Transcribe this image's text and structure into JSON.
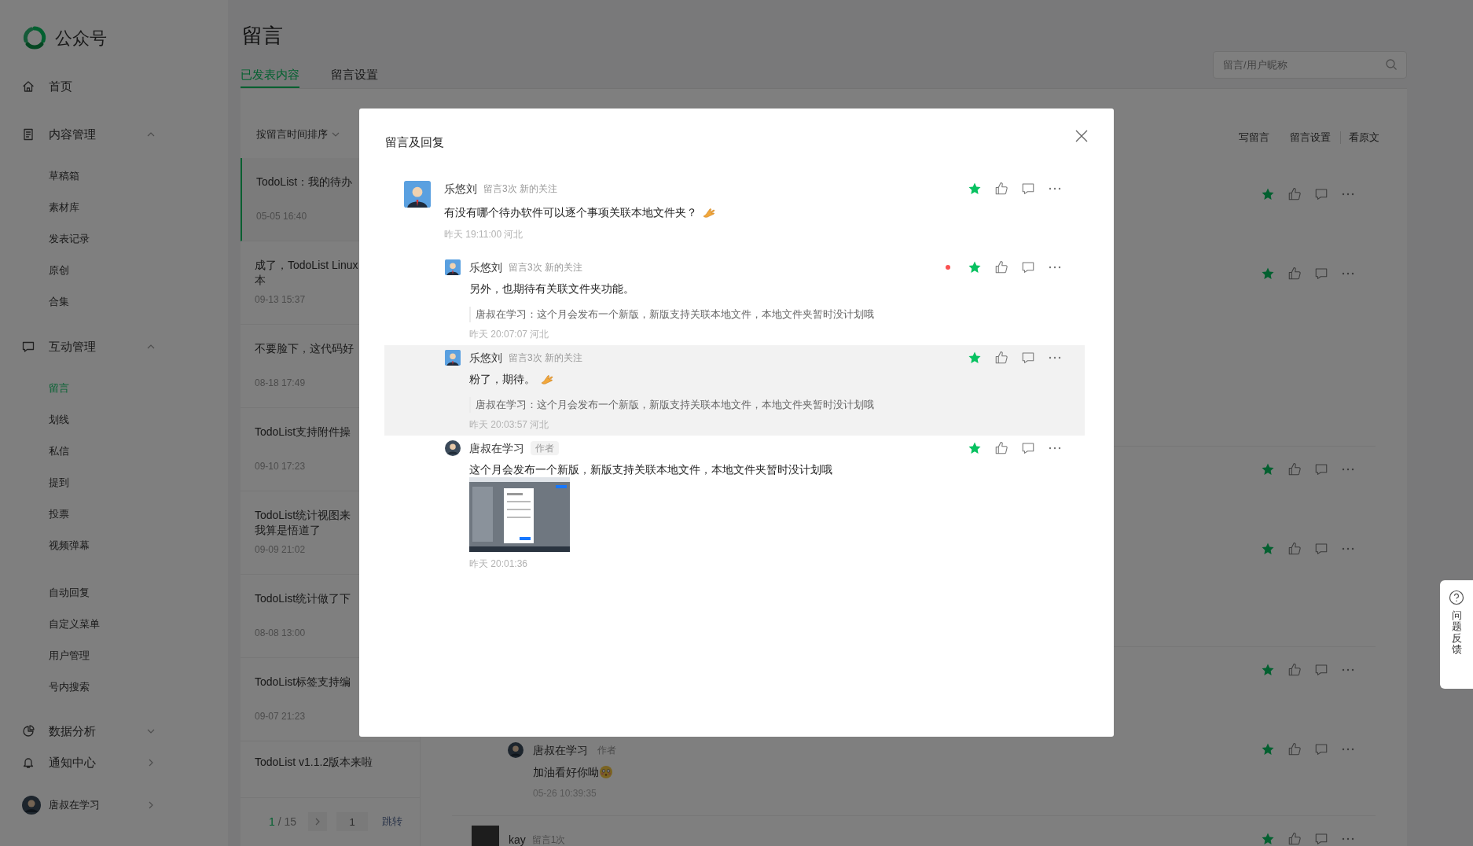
{
  "sidebar": {
    "logo_text": "公众号",
    "items": [
      {
        "kind": "link",
        "label": "首页"
      },
      {
        "kind": "section",
        "label": "内容管理",
        "expanded": true,
        "children": [
          {
            "label": "草稿箱",
            "selected": false
          },
          {
            "label": "素材库",
            "selected": false
          },
          {
            "label": "发表记录",
            "selected": false
          },
          {
            "label": "原创",
            "selected": false
          },
          {
            "label": "合集",
            "selected": false
          }
        ]
      },
      {
        "kind": "section",
        "label": "互动管理",
        "expanded": true,
        "children": [
          {
            "label": "留言",
            "selected": true
          },
          {
            "label": "划线",
            "selected": false
          },
          {
            "label": "私信",
            "selected": false
          },
          {
            "label": "提到",
            "selected": false
          },
          {
            "label": "投票",
            "selected": false
          },
          {
            "label": "视频弹幕",
            "selected": false
          }
        ]
      },
      {
        "kind": "group",
        "children": [
          {
            "label": "自动回复",
            "selected": false
          },
          {
            "label": "自定义菜单",
            "selected": false
          },
          {
            "label": "用户管理",
            "selected": false
          },
          {
            "label": "号内搜索",
            "selected": false
          }
        ]
      },
      {
        "kind": "section",
        "label": "数据分析",
        "expanded": false
      },
      {
        "kind": "nav",
        "label": "通知中心"
      }
    ],
    "user": {
      "name": "唐叔在学习"
    }
  },
  "header": {
    "title": "留言",
    "tabs": [
      {
        "label": "已发表内容",
        "selected": true
      },
      {
        "label": "留言设置",
        "selected": false
      }
    ],
    "search": {
      "placeholder": "留言/用户昵称"
    }
  },
  "article_list": {
    "sort_label": "按留言时间排序",
    "items": [
      {
        "title_lines": [
          "TodoList：我的待办"
        ],
        "date": "05-05 16:40",
        "selected": true
      },
      {
        "title_lines": [
          "成了，TodoList Linux",
          "本"
        ],
        "date": "09-13 15:37",
        "selected": false
      },
      {
        "title_lines": [
          "不要脸下，这代码好"
        ],
        "date": "08-18 17:49",
        "selected": false
      },
      {
        "title_lines": [
          "TodoList支持附件操"
        ],
        "date": "09-10 17:23",
        "selected": false
      },
      {
        "title_lines": [
          "TodoList统计视图来",
          "我算是悟道了"
        ],
        "date": "09-09 21:02",
        "selected": false
      },
      {
        "title_lines": [
          "TodoList统计做了下"
        ],
        "date": "08-08 13:00",
        "selected": false
      },
      {
        "title_lines": [
          "TodoList标签支持编"
        ],
        "date": "09-07 21:23",
        "selected": false
      },
      {
        "title_lines": [
          "TodoList v1.1.2版本来啦"
        ],
        "selected": false
      }
    ],
    "pagination": {
      "current": "1",
      "total_text": "/ 15",
      "page_input": "1",
      "jump": "跳转"
    }
  },
  "comment_panel": {
    "actions": [
      {
        "label": "写留言"
      },
      {
        "label": "留言设置"
      },
      {
        "label": "看原文"
      }
    ],
    "threads": [
      {
        "entries": [
          {
            "kind": "comment",
            "starred": true
          },
          {
            "kind": "reply",
            "starred": true
          }
        ]
      },
      {
        "entries": [
          {
            "kind": "comment",
            "starred": true
          },
          {
            "kind": "reply",
            "starred": true
          }
        ]
      },
      {
        "entries": [
          {
            "kind": "comment",
            "starred": true
          },
          {
            "kind": "reply",
            "starred": true,
            "author": true,
            "name": "唐叔在学习",
            "badge": "作者",
            "text": "加油看好你呦",
            "emoji": true,
            "time": "05-26 10:39:35"
          }
        ]
      },
      {
        "entries": [
          {
            "kind": "comment",
            "starred": true,
            "author": false,
            "name": "kay",
            "meta": "留言1次"
          }
        ]
      }
    ]
  },
  "modal": {
    "title": "留言及回复",
    "comment": {
      "name": "乐悠刘",
      "meta": "留言3次 新的关注",
      "text": "有没有哪个待办软件可以逐个事项关联本地文件夹？",
      "emoji": true,
      "time": "昨天 19:11:00 河北",
      "starred": true,
      "unread": false,
      "author": false,
      "replies": [
        {
          "name": "乐悠刘",
          "meta": "留言3次 新的关注",
          "text": "另外，也期待有关联文件夹功能。",
          "emoji": false,
          "quote": "唐叔在学习：这个月会发布一个新版，新版支持关联本地文件，本地文件夹暂时没计划哦",
          "time": "昨天 20:07:07 河北",
          "starred": true,
          "unread": true,
          "highlighted": false,
          "author": false
        },
        {
          "name": "乐悠刘",
          "meta": "留言3次 新的关注",
          "text": "粉了，期待。",
          "emoji": true,
          "quote": "唐叔在学习：这个月会发布一个新版，新版支持关联本地文件，本地文件夹暂时没计划哦",
          "time": "昨天 20:03:57 河北",
          "starred": true,
          "unread": false,
          "highlighted": true,
          "author": false
        },
        {
          "name": "唐叔在学习",
          "badge": "作者",
          "text": "这个月会发布一个新版，新版支持关联本地文件，本地文件夹暂时没计划哦",
          "emoji": false,
          "image": true,
          "time": "昨天 20:01:36",
          "starred": true,
          "unread": false,
          "highlighted": false,
          "author": true
        }
      ]
    }
  },
  "feedback_tab": {
    "label": "问题反馈"
  }
}
